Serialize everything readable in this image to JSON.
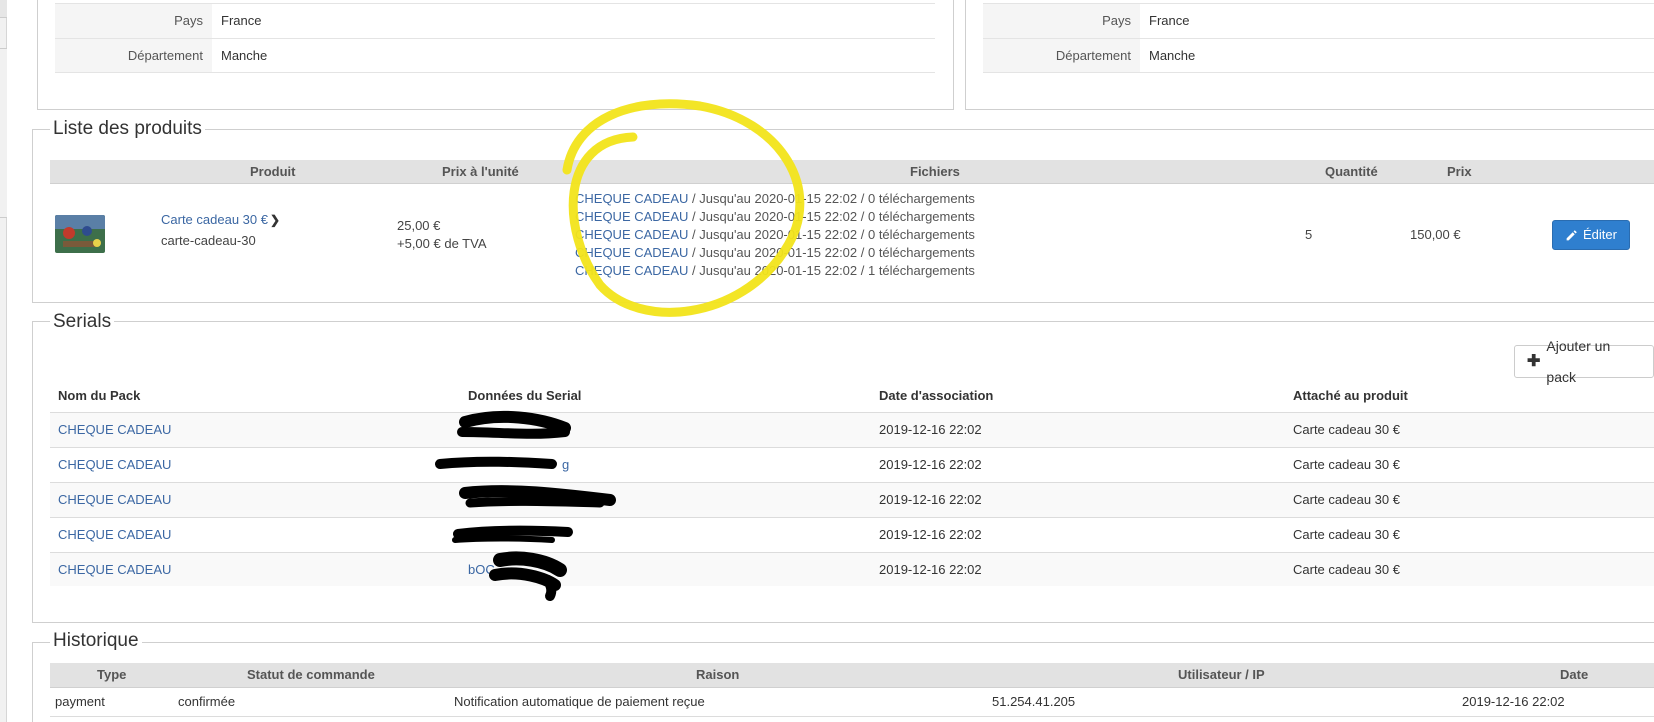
{
  "address_left": {
    "rows": [
      {
        "label": "Pays",
        "value": "France"
      },
      {
        "label": "Département",
        "value": "Manche"
      }
    ]
  },
  "address_right": {
    "rows": [
      {
        "label": "Pays",
        "value": "France"
      },
      {
        "label": "Département",
        "value": "Manche"
      }
    ]
  },
  "products": {
    "legend": "Liste des produits",
    "headers": {
      "product": "Produit",
      "unit_price": "Prix à l'unité",
      "files": "Fichiers",
      "quantity": "Quantité",
      "price": "Prix"
    },
    "item": {
      "name": "Carte cadeau 30 €",
      "code": "carte-cadeau-30",
      "unit_price": "25,00 €",
      "vat": "+5,00 € de TVA",
      "quantity": "5",
      "price": "150,00 €",
      "edit_label": "Éditer",
      "files": [
        {
          "link": "CHEQUE CADEAU",
          "detail": " / Jusqu'au 2020-01-15 22:02 / 0 téléchargements"
        },
        {
          "link": "CHEQUE CADEAU",
          "detail": " / Jusqu'au 2020-01-15 22:02 / 0 téléchargements"
        },
        {
          "link": "CHEQUE CADEAU",
          "detail": " / Jusqu'au 2020-01-15 22:02 / 0 téléchargements"
        },
        {
          "link": "CHEQUE CADEAU",
          "detail": " / Jusqu'au 2020-01-15 22:02 / 0 téléchargements"
        },
        {
          "link": "CHEQUE CADEAU",
          "detail": " / Jusqu'au 2020-01-15 22:02 / 1 téléchargements"
        }
      ]
    }
  },
  "serials": {
    "legend": "Serials",
    "add_pack_label": "Ajouter un pack",
    "headers": {
      "pack": "Nom du Pack",
      "data": "Données du Serial",
      "date": "Date d'association",
      "attached": "Attaché au produit"
    },
    "rows": [
      {
        "pack": "CHEQUE CADEAU",
        "data": "",
        "date": "2019-12-16 22:02",
        "attached": "Carte cadeau 30 €"
      },
      {
        "pack": "CHEQUE CADEAU",
        "data": "g",
        "date": "2019-12-16 22:02",
        "attached": "Carte cadeau 30 €"
      },
      {
        "pack": "CHEQUE CADEAU",
        "data": "",
        "date": "2019-12-16 22:02",
        "attached": "Carte cadeau 30 €"
      },
      {
        "pack": "CHEQUE CADEAU",
        "data": "",
        "date": "2019-12-16 22:02",
        "attached": "Carte cadeau 30 €"
      },
      {
        "pack": "CHEQUE CADEAU",
        "data": "bOC",
        "date": "2019-12-16 22:02",
        "attached": "Carte cadeau 30 €"
      }
    ]
  },
  "history": {
    "legend": "Historique",
    "headers": {
      "type": "Type",
      "status": "Statut de commande",
      "reason": "Raison",
      "user_ip": "Utilisateur / IP",
      "date": "Date"
    },
    "rows": [
      {
        "type": "payment",
        "status": "confirmée",
        "reason": "Notification automatique de paiement reçue",
        "user_ip": "51.254.41.205",
        "date": "2019-12-16 22:02"
      }
    ]
  },
  "colors": {
    "link": "#3b67a3",
    "edit_button": "#2f7fcf",
    "header_bg": "#e2e2e2",
    "annotation": "#f2e41a",
    "redaction": "#000000"
  },
  "icons": {
    "chevron": "chevron-right-icon",
    "edit": "pencil-icon",
    "add": "plus-icon"
  }
}
